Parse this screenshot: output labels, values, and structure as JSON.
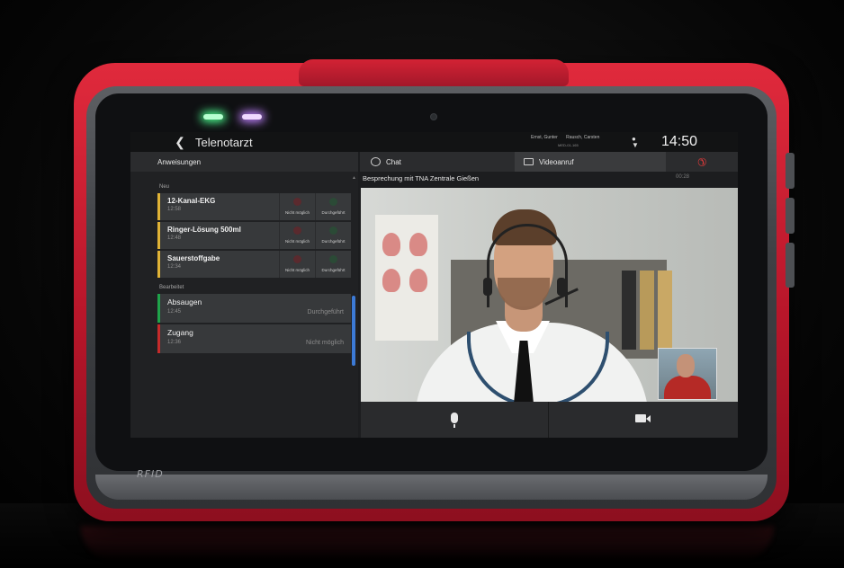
{
  "app": {
    "title": "Telenotarzt",
    "time": "14:50"
  },
  "header_users": {
    "user1": "Ernst, Gunter",
    "user2": "Rausch, Carsten",
    "sub": "MED-01-165"
  },
  "columns": {
    "instructions": "Anweisungen",
    "chat": "Chat",
    "video": "Videoanruf"
  },
  "tasks": {
    "new_label": "Neu",
    "done_label": "Bearbeitet",
    "action_not_possible": "Nicht möglich",
    "action_done": "Durchgeführt",
    "new_items": [
      {
        "name": "12-Kanal-EKG",
        "time": "12:58"
      },
      {
        "name": "Ringer-Lösung 500ml",
        "time": "12:48"
      },
      {
        "name": "Sauerstoffgabe",
        "time": "12:34"
      }
    ],
    "done_items": [
      {
        "name": "Absaugen",
        "time": "12:45",
        "result": "Durchgeführt"
      },
      {
        "name": "Zugang",
        "time": "12:36",
        "result": "Nicht möglich"
      }
    ]
  },
  "video": {
    "title": "Besprechung mit TNA Zentrale Gießen",
    "duration": "00:28"
  },
  "device": {
    "brand": "RFID"
  },
  "colors": {
    "device_red": "#d32234",
    "new_task_bar": "#e0b336",
    "done_green": "#1fa34a",
    "done_red": "#c52b2b",
    "scroll_blue": "#3c7ad6",
    "hangup_red": "#e23a3a"
  },
  "icons": [
    "back-icon",
    "chat-icon",
    "video-icon",
    "hangup-icon",
    "mic-icon",
    "camera-icon"
  ]
}
